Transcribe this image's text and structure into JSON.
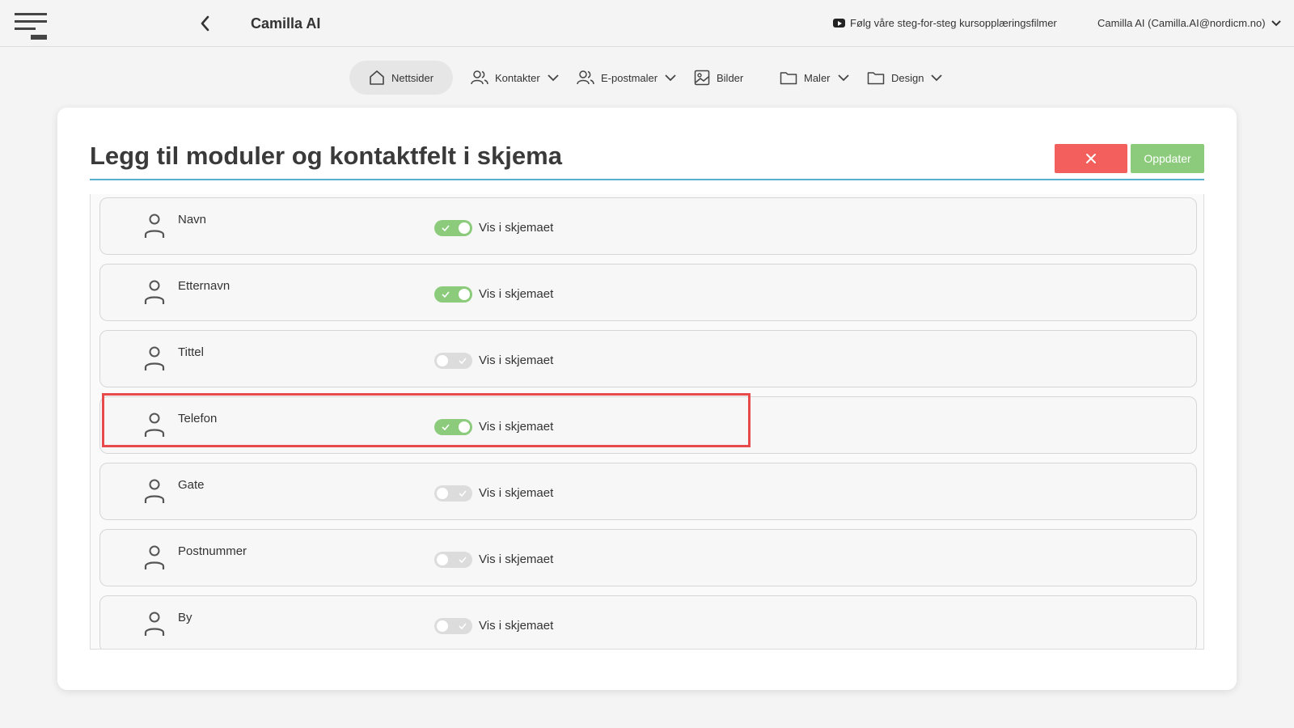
{
  "header": {
    "app_title": "Camilla AI",
    "tutorial_link": "Følg våre steg-for-steg kursopplæringsfilmer",
    "user_label": "Camilla AI (Camilla.AI@nordicm.no)"
  },
  "nav": {
    "items": [
      {
        "label": "Nettsider",
        "icon": "home-icon",
        "active": true
      },
      {
        "label": "Kontakter",
        "icon": "users-icon",
        "dropdown": true
      },
      {
        "label": "E-postmaler",
        "icon": "users-icon",
        "dropdown": true
      },
      {
        "label": "Bilder",
        "icon": "image-icon"
      },
      {
        "label": "Maler",
        "icon": "folder-icon",
        "dropdown": true
      },
      {
        "label": "Design",
        "icon": "folder-icon",
        "dropdown": true
      }
    ]
  },
  "dialog": {
    "title": "Legg til moduler og kontaktfelt i skjema",
    "update_label": "Oppdater",
    "close_icon": "close-icon"
  },
  "fields": [
    {
      "label": "Navn",
      "toggle_label": "Vis i skjemaet",
      "enabled": true
    },
    {
      "label": "Etternavn",
      "toggle_label": "Vis i skjemaet",
      "enabled": true
    },
    {
      "label": "Tittel",
      "toggle_label": "Vis i skjemaet",
      "enabled": false
    },
    {
      "label": "Telefon",
      "toggle_label": "Vis i skjemaet",
      "enabled": true
    },
    {
      "label": "Gate",
      "toggle_label": "Vis i skjemaet",
      "enabled": false
    },
    {
      "label": "Postnummer",
      "toggle_label": "Vis i skjemaet",
      "enabled": false
    },
    {
      "label": "By",
      "toggle_label": "Vis i skjemaet",
      "enabled": false
    }
  ],
  "colors": {
    "accent_green": "#8ccb7c",
    "close_red": "#f25f5c",
    "rule_blue": "#5aaed0",
    "highlight_red": "#e8494a"
  }
}
